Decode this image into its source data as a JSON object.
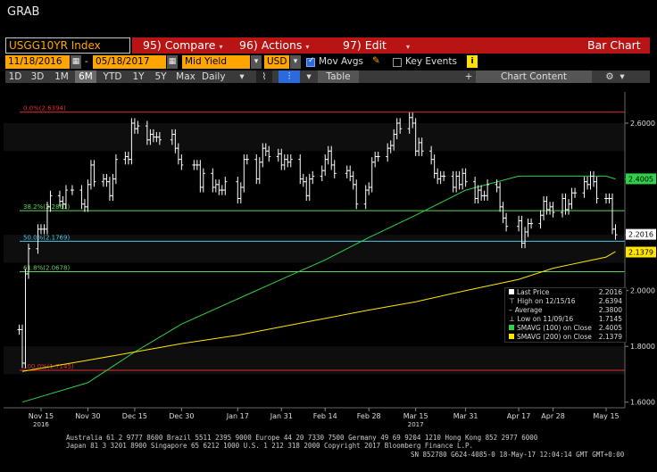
{
  "window_title": "GRAB",
  "toolbar": {
    "ticker": "USGG10YR Index",
    "compare": "95) Compare",
    "actions": "96) Actions",
    "edit": "97) Edit",
    "chart_type": "Bar Chart"
  },
  "settings": {
    "start_date": "11/18/2016",
    "end_date": "05/18/2017",
    "field": "Mid Yield",
    "currency": "USD",
    "mov_avgs_label": "Mov Avgs",
    "key_events_label": "Key Events",
    "mov_avgs_checked": true,
    "key_events_checked": false
  },
  "ranges": [
    "1D",
    "3D",
    "1M",
    "6M",
    "YTD",
    "1Y",
    "5Y",
    "Max"
  ],
  "selected_range": "6M",
  "period": "Daily",
  "table_label": "Table",
  "chart_content_label": "Chart Content",
  "chart_data": {
    "type": "bar",
    "x_labels": [
      {
        "label": "Nov 15",
        "sub": "2016",
        "date": "2016-11-15"
      },
      {
        "label": "Nov 30",
        "sub": "",
        "date": "2016-11-30"
      },
      {
        "label": "Dec 15",
        "sub": "",
        "date": "2016-12-15"
      },
      {
        "label": "Dec 30",
        "sub": "",
        "date": "2016-12-30"
      },
      {
        "label": "Jan 17",
        "sub": "",
        "date": "2017-01-17"
      },
      {
        "label": "Jan 31",
        "sub": "",
        "date": "2017-01-31"
      },
      {
        "label": "Feb 14",
        "sub": "",
        "date": "2017-02-14"
      },
      {
        "label": "Feb 28",
        "sub": "",
        "date": "2017-02-28"
      },
      {
        "label": "Mar 15",
        "sub": "2017",
        "date": "2017-03-15"
      },
      {
        "label": "Mar 31",
        "sub": "",
        "date": "2017-03-31"
      },
      {
        "label": "Apr 17",
        "sub": "",
        "date": "2017-04-17"
      },
      {
        "label": "Apr 28",
        "sub": "",
        "date": "2017-04-28"
      },
      {
        "label": "May 15",
        "sub": "",
        "date": "2017-05-15"
      }
    ],
    "y_ticks": [
      "2.6000",
      "2.4000",
      "2.2000",
      "2.0000",
      "1.8000",
      "1.6000"
    ],
    "ylim": [
      1.58,
      2.68
    ],
    "fib_levels": [
      {
        "label": "0.0%(2.6394)",
        "value": 2.6394,
        "color": "#e03030"
      },
      {
        "label": "38.2%(2.2861)",
        "value": 2.2861,
        "color": "#5ad65a"
      },
      {
        "label": "50.0%(2.1769)",
        "value": 2.1769,
        "color": "#4fc8e8"
      },
      {
        "label": "61.8%(2.0678)",
        "value": 2.0678,
        "color": "#5ad65a"
      },
      {
        "label": "100.0%(1.7145)",
        "value": 1.7145,
        "color": "#e03030"
      }
    ],
    "right_tags": [
      {
        "label": "2.4005",
        "value": 2.4005,
        "color": "#2fd14a"
      },
      {
        "label": "2.2016",
        "value": 2.2016,
        "color": "#ffffff"
      },
      {
        "label": "2.1379",
        "value": 2.1379,
        "color": "#ffe600"
      }
    ],
    "series": [
      {
        "name": "Last Price",
        "kind": "bars",
        "color": "#ffffff",
        "dates": [
          "2016-11-08",
          "2016-11-09",
          "2016-11-10",
          "2016-11-11",
          "2016-11-14",
          "2016-11-15",
          "2016-11-16",
          "2016-11-17",
          "2016-11-18",
          "2016-11-21",
          "2016-11-22",
          "2016-11-23",
          "2016-11-25",
          "2016-11-28",
          "2016-11-29",
          "2016-11-30",
          "2016-12-01",
          "2016-12-02",
          "2016-12-05",
          "2016-12-06",
          "2016-12-07",
          "2016-12-08",
          "2016-12-09",
          "2016-12-12",
          "2016-12-13",
          "2016-12-14",
          "2016-12-15",
          "2016-12-16",
          "2016-12-19",
          "2016-12-20",
          "2016-12-21",
          "2016-12-22",
          "2016-12-23",
          "2016-12-27",
          "2016-12-28",
          "2016-12-29",
          "2016-12-30",
          "2017-01-03",
          "2017-01-04",
          "2017-01-05",
          "2017-01-06",
          "2017-01-09",
          "2017-01-10",
          "2017-01-11",
          "2017-01-12",
          "2017-01-13",
          "2017-01-17",
          "2017-01-18",
          "2017-01-19",
          "2017-01-20",
          "2017-01-23",
          "2017-01-24",
          "2017-01-25",
          "2017-01-26",
          "2017-01-27",
          "2017-01-30",
          "2017-01-31",
          "2017-02-01",
          "2017-02-02",
          "2017-02-03",
          "2017-02-06",
          "2017-02-07",
          "2017-02-08",
          "2017-02-09",
          "2017-02-10",
          "2017-02-13",
          "2017-02-14",
          "2017-02-15",
          "2017-02-16",
          "2017-02-17",
          "2017-02-21",
          "2017-02-22",
          "2017-02-23",
          "2017-02-24",
          "2017-02-27",
          "2017-02-28",
          "2017-03-01",
          "2017-03-02",
          "2017-03-03",
          "2017-03-06",
          "2017-03-07",
          "2017-03-08",
          "2017-03-09",
          "2017-03-10",
          "2017-03-13",
          "2017-03-14",
          "2017-03-15",
          "2017-03-16",
          "2017-03-17",
          "2017-03-20",
          "2017-03-21",
          "2017-03-22",
          "2017-03-23",
          "2017-03-24",
          "2017-03-27",
          "2017-03-28",
          "2017-03-29",
          "2017-03-30",
          "2017-03-31",
          "2017-04-03",
          "2017-04-04",
          "2017-04-05",
          "2017-04-06",
          "2017-04-07",
          "2017-04-10",
          "2017-04-11",
          "2017-04-12",
          "2017-04-13",
          "2017-04-17",
          "2017-04-18",
          "2017-04-19",
          "2017-04-20",
          "2017-04-21",
          "2017-04-24",
          "2017-04-25",
          "2017-04-26",
          "2017-04-27",
          "2017-04-28",
          "2017-05-01",
          "2017-05-02",
          "2017-05-03",
          "2017-05-04",
          "2017-05-05",
          "2017-05-08",
          "2017-05-09",
          "2017-05-10",
          "2017-05-11",
          "2017-05-12",
          "2017-05-15",
          "2017-05-16",
          "2017-05-17",
          "2017-05-18"
        ],
        "closes": [
          1.86,
          1.74,
          2.06,
          2.15,
          2.22,
          2.22,
          2.22,
          2.3,
          2.34,
          2.32,
          2.31,
          2.36,
          2.36,
          2.31,
          2.3,
          2.38,
          2.45,
          2.39,
          2.4,
          2.39,
          2.34,
          2.4,
          2.47,
          2.48,
          2.47,
          2.6,
          2.58,
          2.59,
          2.54,
          2.56,
          2.55,
          2.55,
          2.54,
          2.56,
          2.51,
          2.47,
          2.45,
          2.45,
          2.45,
          2.37,
          2.42,
          2.37,
          2.38,
          2.36,
          2.36,
          2.39,
          2.33,
          2.37,
          2.47,
          2.47,
          2.4,
          2.46,
          2.51,
          2.5,
          2.48,
          2.49,
          2.45,
          2.47,
          2.46,
          2.47,
          2.4,
          2.39,
          2.34,
          2.4,
          2.41,
          2.43,
          2.47,
          2.5,
          2.45,
          2.42,
          2.43,
          2.41,
          2.38,
          2.31,
          2.36,
          2.37,
          2.46,
          2.48,
          2.48,
          2.51,
          2.52,
          2.56,
          2.6,
          2.58,
          2.62,
          2.6,
          2.5,
          2.53,
          2.5,
          2.47,
          2.42,
          2.4,
          2.41,
          2.41,
          2.37,
          2.41,
          2.38,
          2.42,
          2.39,
          2.33,
          2.36,
          2.34,
          2.34,
          2.38,
          2.37,
          2.3,
          2.26,
          2.23,
          2.25,
          2.17,
          2.21,
          2.24,
          2.24,
          2.27,
          2.32,
          2.29,
          2.3,
          2.28,
          2.33,
          2.29,
          2.31,
          2.35,
          2.35,
          2.39,
          2.38,
          2.41,
          2.39,
          2.33,
          2.33,
          2.33,
          2.22,
          2.2
        ]
      },
      {
        "name": "SMAVG (100) on Close",
        "kind": "line",
        "color": "#2fd14a",
        "value": "2.4005",
        "dates": [
          "2016-11-09",
          "2016-11-30",
          "2016-12-15",
          "2016-12-30",
          "2017-01-17",
          "2017-01-31",
          "2017-02-14",
          "2017-02-28",
          "2017-03-15",
          "2017-03-31",
          "2017-04-17",
          "2017-04-28",
          "2017-05-15",
          "2017-05-18"
        ],
        "values": [
          1.6,
          1.67,
          1.78,
          1.88,
          1.97,
          2.04,
          2.11,
          2.19,
          2.27,
          2.36,
          2.41,
          2.41,
          2.41,
          2.4
        ]
      },
      {
        "name": "SMAVG (200) on Close",
        "kind": "line",
        "color": "#ffe600",
        "value": "2.1379",
        "dates": [
          "2016-11-09",
          "2016-11-30",
          "2016-12-15",
          "2016-12-30",
          "2017-01-17",
          "2017-01-31",
          "2017-02-14",
          "2017-02-28",
          "2017-03-15",
          "2017-03-31",
          "2017-04-17",
          "2017-04-28",
          "2017-05-15",
          "2017-05-18"
        ],
        "values": [
          1.71,
          1.75,
          1.78,
          1.81,
          1.84,
          1.87,
          1.9,
          1.93,
          1.96,
          2.0,
          2.04,
          2.08,
          2.12,
          2.14
        ]
      }
    ],
    "legend": [
      {
        "label": "Last Price",
        "value": "2.2016",
        "marker": "square-white"
      },
      {
        "label": "High on 12/15/16",
        "value": "2.6394",
        "marker": "up"
      },
      {
        "label": "Average",
        "value": "2.3800",
        "marker": "dash"
      },
      {
        "label": "Low on 11/09/16",
        "value": "1.7145",
        "marker": "down"
      },
      {
        "label": "SMAVG (100) on Close",
        "value": "2.4005",
        "marker": "square-green"
      },
      {
        "label": "SMAVG (200) on Close",
        "value": "2.1379",
        "marker": "square-yellow"
      }
    ]
  },
  "footer": {
    "line1": "Australia 61 2 9777 8600 Brazil 5511 2395 9000 Europe 44 20 7330 7500 Germany 49 69 9204 1210 Hong Kong 852 2977 6000",
    "line2": "Japan 81 3 3201 8900        Singapore 65 6212 1000        U.S. 1 212 318 2000        Copyright 2017 Bloomberg Finance L.P.",
    "line3": "SN 852780 G624-4085-0 18-May-17 12:04:14 GMT  GMT+0:00"
  }
}
